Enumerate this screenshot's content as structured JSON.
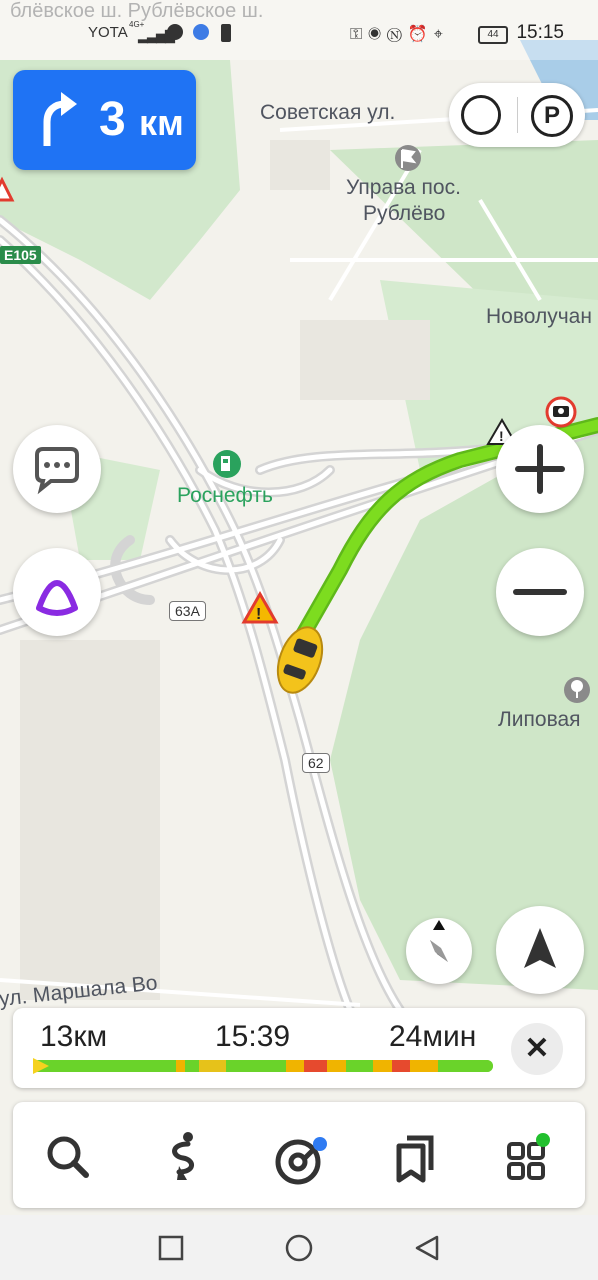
{
  "status_bar": {
    "carrier": "YOTA",
    "network": "4G+",
    "battery": "44",
    "time": "15:15"
  },
  "map": {
    "top_street_text": "блёвское ш. Рублёвское ш.",
    "labels": {
      "sovetskaya": "Советская ул.",
      "uprava_line1": "Управа пос.",
      "uprava_line2": "Рублёво",
      "novoluchan": "Новолучан",
      "rosneft": "Роснефть",
      "lipovaya": "Липовая",
      "marshala": "ул. Маршала Во"
    },
    "road_signs": {
      "e105": "E105",
      "r63a": "63А",
      "r62": "62"
    },
    "colors": {
      "route": "#7ddc1f",
      "forest": "#cfe6c8",
      "road": "#d8d8d8"
    }
  },
  "maneuver": {
    "icon": "turn-right-arrow-icon",
    "distance": "3",
    "unit": "км"
  },
  "top_controls": {
    "traffic_icon": "traffic-icon",
    "parking_label": "P"
  },
  "side_buttons": {
    "chat_icon": "chat-icon",
    "alice_icon": "alice-icon",
    "zoom_in_icon": "plus-icon",
    "zoom_out_icon": "minus-icon",
    "compass_icon": "compass-icon",
    "locate_icon": "navigation-arrow-icon"
  },
  "route_summary": {
    "distance": "13км",
    "arrival": "15:39",
    "duration": "24мин",
    "close_label": "✕",
    "traffic_segments": [
      {
        "from": 0.0,
        "to": 0.31,
        "color": "#6ad32a"
      },
      {
        "from": 0.31,
        "to": 0.33,
        "color": "#f0b400"
      },
      {
        "from": 0.33,
        "to": 0.36,
        "color": "#6ad32a"
      },
      {
        "from": 0.36,
        "to": 0.42,
        "color": "#e6c21a"
      },
      {
        "from": 0.42,
        "to": 0.55,
        "color": "#6ad32a"
      },
      {
        "from": 0.55,
        "to": 0.59,
        "color": "#f0b400"
      },
      {
        "from": 0.59,
        "to": 0.64,
        "color": "#e64a2e"
      },
      {
        "from": 0.64,
        "to": 0.68,
        "color": "#f0b400"
      },
      {
        "from": 0.68,
        "to": 0.74,
        "color": "#6ad32a"
      },
      {
        "from": 0.74,
        "to": 0.78,
        "color": "#f0b400"
      },
      {
        "from": 0.78,
        "to": 0.82,
        "color": "#e64a2e"
      },
      {
        "from": 0.82,
        "to": 0.88,
        "color": "#f0b400"
      },
      {
        "from": 0.88,
        "to": 1.0,
        "color": "#6ad32a"
      }
    ]
  },
  "bottom_toolbar": {
    "search_icon": "search-icon",
    "route_icon": "route-icon",
    "music_icon": "music-icon",
    "bookmarks_icon": "bookmarks-icon",
    "services_icon": "services-icon"
  },
  "system_nav": {
    "recent_icon": "square-icon",
    "home_icon": "circle-icon",
    "back_icon": "triangle-icon"
  }
}
